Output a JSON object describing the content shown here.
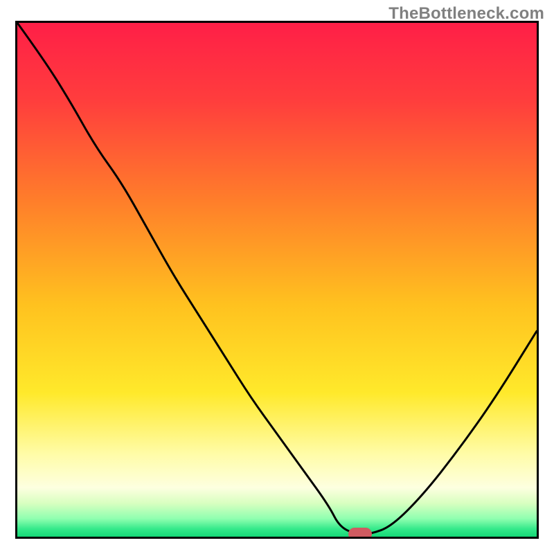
{
  "watermark": "TheBottleneck.com",
  "colors": {
    "frame": "#000000",
    "curve": "#000000",
    "marker": "#cf5b61",
    "gradient_stops": [
      {
        "offset": 0.0,
        "color": "#ff1f47"
      },
      {
        "offset": 0.15,
        "color": "#ff3d3d"
      },
      {
        "offset": 0.35,
        "color": "#ff7f2a"
      },
      {
        "offset": 0.55,
        "color": "#ffc21f"
      },
      {
        "offset": 0.72,
        "color": "#ffe92b"
      },
      {
        "offset": 0.84,
        "color": "#fffca8"
      },
      {
        "offset": 0.905,
        "color": "#fdffe0"
      },
      {
        "offset": 0.935,
        "color": "#d8ffc0"
      },
      {
        "offset": 0.965,
        "color": "#8fffb0"
      },
      {
        "offset": 0.985,
        "color": "#34e98a"
      },
      {
        "offset": 1.0,
        "color": "#15d877"
      }
    ]
  },
  "chart_data": {
    "type": "line",
    "title": "",
    "xlabel": "",
    "ylabel": "",
    "xlim": [
      0,
      100
    ],
    "ylim": [
      0,
      100
    ],
    "grid": false,
    "legend": false,
    "series": [
      {
        "name": "bottleneck-curve",
        "x": [
          0,
          5,
          10,
          15,
          20,
          25,
          30,
          35,
          40,
          45,
          50,
          55,
          60,
          62,
          65,
          68,
          72,
          78,
          85,
          92,
          100
        ],
        "y": [
          100,
          93,
          85,
          76,
          69,
          60,
          51,
          43,
          35,
          27,
          20,
          13,
          6,
          2,
          0.5,
          0.5,
          2,
          8,
          17,
          27,
          40
        ]
      }
    ],
    "annotations": [
      {
        "name": "optimum-marker",
        "type": "pill",
        "x": 66,
        "y": 0.5
      }
    ]
  }
}
